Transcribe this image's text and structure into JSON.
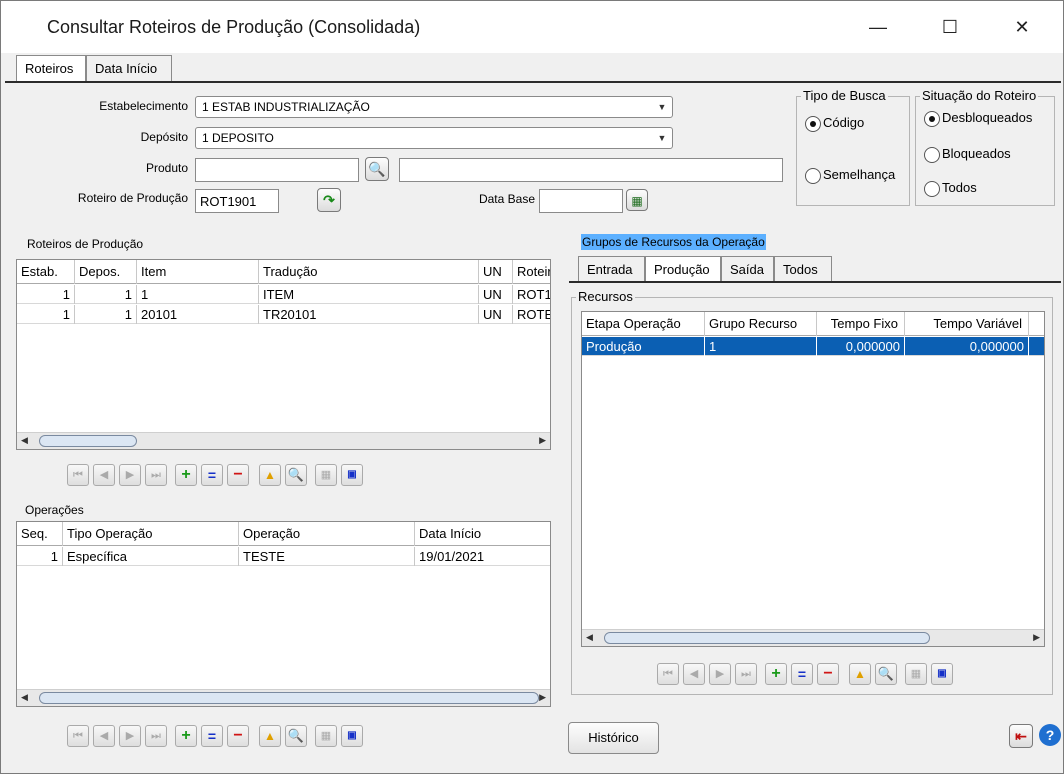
{
  "window": {
    "title": "Consultar Roteiros de Produção (Consolidada)",
    "minimize": "—",
    "maximize": "☐",
    "close": "✕"
  },
  "top_tabs": [
    {
      "label": "Roteiros"
    },
    {
      "label": "Data Início"
    }
  ],
  "form": {
    "estabelecimento_label": "Estabelecimento",
    "estabelecimento_value": "1 ESTAB INDUSTRIALIZAÇÃO",
    "deposito_label": "Depósito",
    "deposito_value": "1 DEPOSITO",
    "produto_label": "Produto",
    "produto_value": "",
    "produto_desc": "",
    "roteiro_label": "Roteiro de Produção",
    "roteiro_value": "ROT1901",
    "data_base_label": "Data Base",
    "data_base_value": ""
  },
  "tipo_busca": {
    "title": "Tipo de Busca",
    "options": [
      {
        "label": "Código",
        "checked": true
      },
      {
        "label": "Semelhança",
        "checked": false
      }
    ]
  },
  "situacao": {
    "title": "Situação do Roteiro",
    "options": [
      {
        "label": "Desbloqueados",
        "checked": true
      },
      {
        "label": "Bloqueados",
        "checked": false
      },
      {
        "label": "Todos",
        "checked": false
      }
    ]
  },
  "roteiros": {
    "title": "Roteiros de Produção",
    "columns": [
      "Estab.",
      "Depos.",
      "Item",
      "Tradução",
      "UN",
      "Roteiro"
    ],
    "rows": [
      [
        "1",
        "1",
        "1",
        "ITEM",
        "UN",
        "ROT1"
      ],
      [
        "1",
        "1",
        "20101",
        "TR20101",
        "UN",
        "ROTE"
      ]
    ]
  },
  "operacoes": {
    "title": "Operações",
    "columns": [
      "Seq.",
      "Tipo Operação",
      "Operação",
      "Data Início"
    ],
    "rows": [
      [
        "1",
        "Específica",
        "TESTE",
        "19/01/2021"
      ]
    ]
  },
  "grupos": {
    "title": "Grupos de Recursos da Operação",
    "tabs": [
      {
        "label": "Entrada"
      },
      {
        "label": "Produção"
      },
      {
        "label": "Saída"
      },
      {
        "label": "Todos"
      }
    ],
    "recursos_title": "Recursos",
    "columns": [
      "Etapa Operação",
      "Grupo Recurso",
      "Tempo Fixo",
      "Tempo Variável"
    ],
    "rows": [
      [
        "Produção",
        "1",
        "0,000000",
        "0,000000"
      ]
    ]
  },
  "buttons": {
    "historico": "Histórico"
  }
}
